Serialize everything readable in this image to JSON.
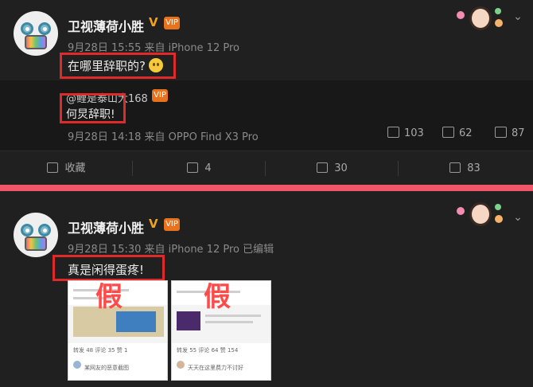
{
  "posts": [
    {
      "author": "卫视薄荷小胜",
      "verified_mark": "V",
      "vip_badge": "VIP",
      "meta": "9月28日 15:55 来自 iPhone 12 Pro",
      "text": "在哪里辞职的?",
      "repost": {
        "author": "@鲤是泰山大168",
        "text": "何炅辞职!",
        "meta": "9月28日 14:18 来自 OPPO Find X3 Pro",
        "stats": {
          "reposts": "103",
          "comments": "62",
          "likes": "87"
        }
      },
      "actions": {
        "favorite": "收藏",
        "repost": "4",
        "comment": "30",
        "like": "83"
      }
    },
    {
      "author": "卫视薄荷小胜",
      "verified_mark": "V",
      "vip_badge": "VIP",
      "meta": "9月28日 15:30 来自 iPhone 12 Pro   已编辑",
      "text": "真是闲得蛋疼!",
      "images": [
        {
          "overlay": "假",
          "tabs": "转发 48   评论 35   赞 1",
          "caption": "某网友的恶意截图"
        },
        {
          "overlay": "假",
          "tabs": "转发 55   评论 64   赞 154",
          "caption": "天天在这里费力不讨好"
        }
      ]
    }
  ],
  "colors": {
    "background": "#202020",
    "repost_bg": "#181818",
    "divider": "#f0556a",
    "highlight_box": "#e02a2a",
    "verified": "#f0a11d"
  },
  "icons": [
    "star-icon",
    "repost-icon",
    "comment-icon",
    "like-icon",
    "chevron-down-icon",
    "emoji-icon"
  ]
}
